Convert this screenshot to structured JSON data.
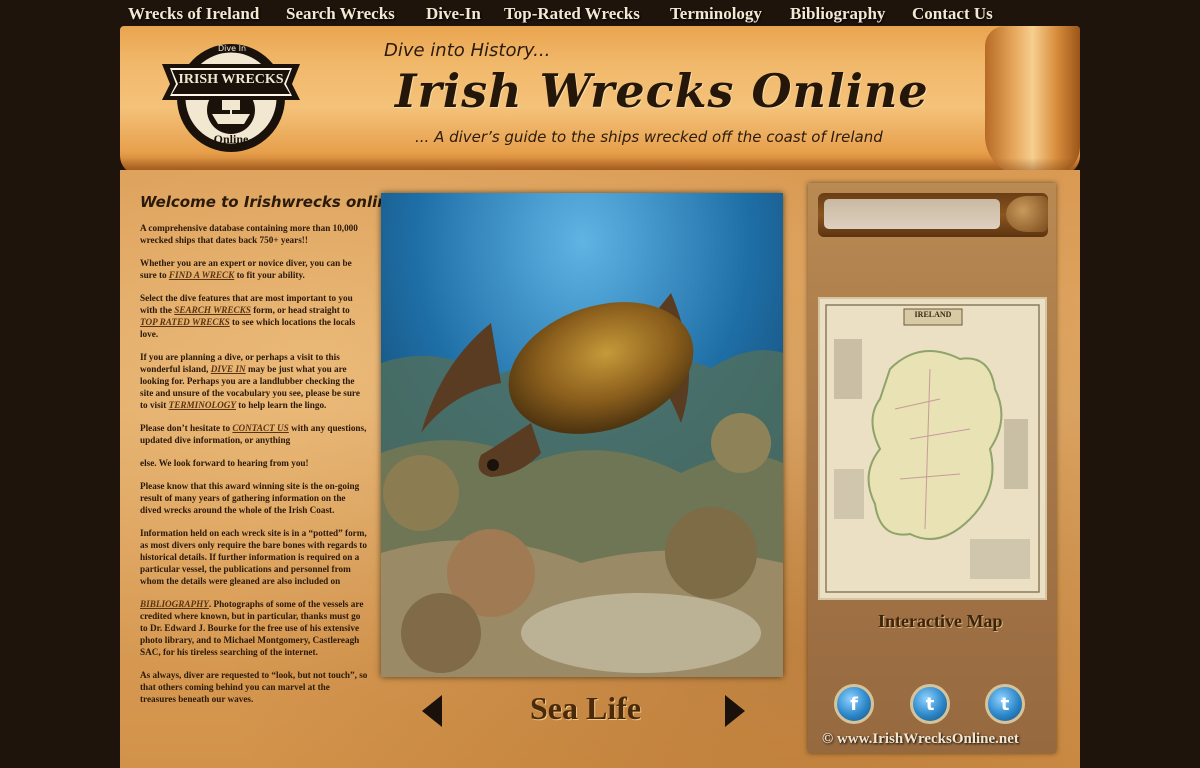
{
  "nav": {
    "items": [
      {
        "label": "Wrecks of Ireland"
      },
      {
        "label": "Search Wrecks"
      },
      {
        "label": "Dive-In"
      },
      {
        "label": "Top-Rated Wrecks"
      },
      {
        "label": "Terminology"
      },
      {
        "label": "Bibliography"
      },
      {
        "label": "Contact Us"
      }
    ]
  },
  "header": {
    "logo": {
      "top": "Dive In",
      "name": "IRISH WRECKS",
      "bottom": "Online"
    },
    "tagline": "Dive into History...",
    "title": "Irish Wrecks Online",
    "subtitle": "... A diver’s guide to the ships wrecked off the coast of Ireland"
  },
  "welcome": {
    "heading": "Welcome to Irishwrecks online,",
    "p1": "A comprehensive database containing more than 10,000 wrecked ships that dates back 750+ years!!",
    "p2_a": "Whether you are an expert or novice diver, you can be sure to ",
    "p2_link": "FIND A WRECK",
    "p2_b": " to fit your ability.",
    "p3_a": "Select the dive features that are most important to you with the ",
    "p3_link1": "SEARCH WRECKS",
    "p3_b": " form, or head straight to ",
    "p3_link2": "TOP RATED WRECKS",
    "p3_c": " to see which locations the locals love.",
    "p4_a": "If you are planning a dive, or perhaps a visit to this wonderful island, ",
    "p4_link1": "DIVE IN",
    "p4_b": " may be just what you are looking for. Perhaps you are a landlubber checking the site and unsure of the vocabulary you see, please be sure to visit ",
    "p4_link2": "TERMINOLOGY",
    "p4_c": " to help learn the lingo.",
    "p5_a": "Please don’t hesitate to ",
    "p5_link": "CONTACT US",
    "p5_b": " with any questions, updated dive information, or anything",
    "p6": "else. We look forward to hearing from you!",
    "p7": "Please know that this award winning site is the on-going result of many years of gathering information on the dived wrecks around the whole of the Irish Coast.",
    "p8": "Information held on each wreck site is in a “potted” form, as most divers only require the bare bones with regards to historical details.  If further information is required on a particular vessel, the publications and personnel from whom the details were gleaned are also included on",
    "p9_link": "BIBLIOGRAPHY",
    "p9_a": ".  Photographs of some of the vessels are credited where known, but in particular, thanks must go to Dr. Edward J. Bourke for the free use of his extensive photo library, and to Michael Montgomery, Castlereagh SAC, for his tireless searching of the internet.",
    "p10": "As always, diver are requested to “look, but not touch”, so that others coming behind you can marvel at the treasures beneath our waves."
  },
  "slideshow": {
    "caption": "Sea Life"
  },
  "sidebar": {
    "search_placeholder": "",
    "map_title": "IRELAND",
    "map_label": "Interactive Map",
    "social": [
      {
        "name": "facebook",
        "glyph": "f"
      },
      {
        "name": "twitter",
        "glyph": "t"
      },
      {
        "name": "twitter",
        "glyph": "t"
      }
    ],
    "copyright": "© www.IrishWrecksOnline.net"
  }
}
